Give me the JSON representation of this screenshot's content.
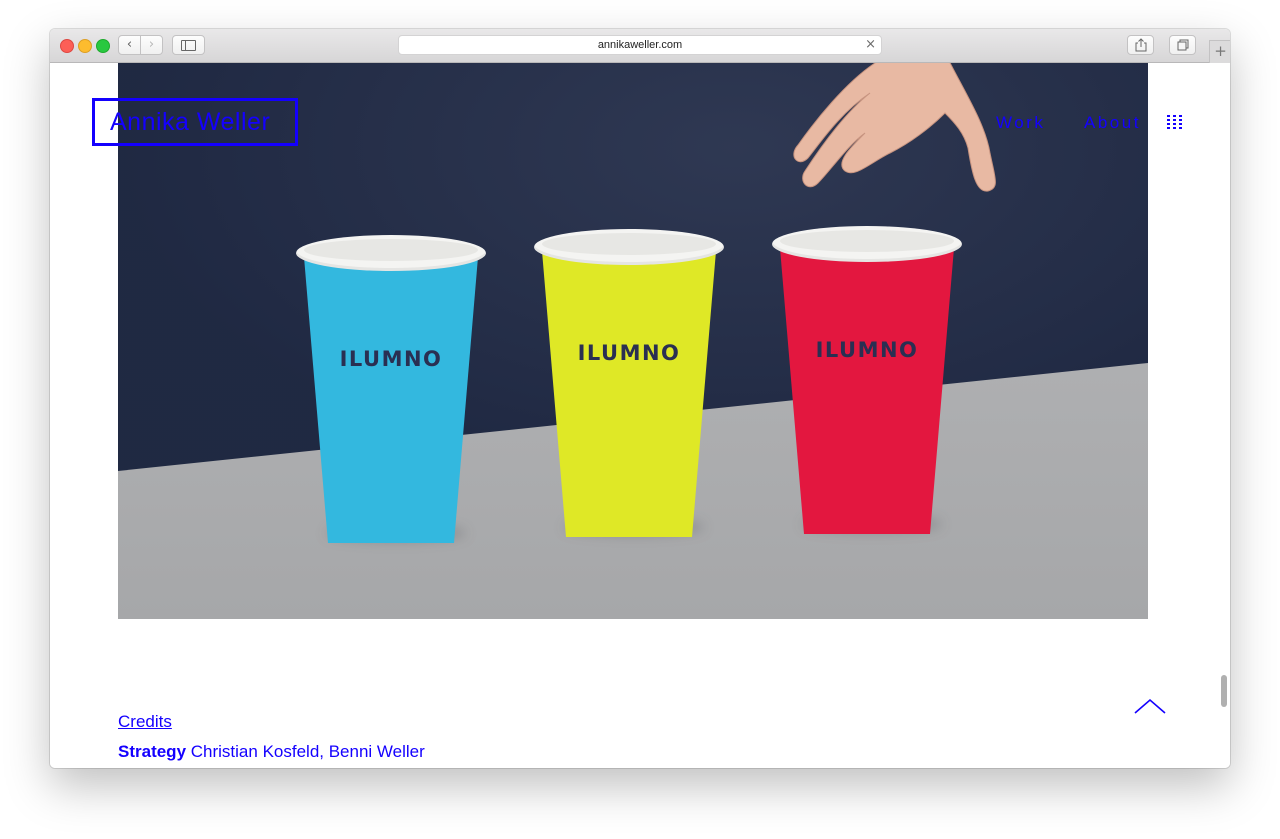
{
  "browser": {
    "url": "annikaweller.com",
    "back_glyph": "‹",
    "forward_glyph": "›",
    "close_glyph": "×",
    "new_tab_glyph": "+",
    "icons": [
      "back-icon",
      "forward-icon",
      "sidebar-icon",
      "share-icon",
      "tabs-icon",
      "new-tab-icon"
    ]
  },
  "site": {
    "logo": "Annika Weller",
    "nav": {
      "work": "Work",
      "about": "About"
    },
    "menu_icon": "grid-icon",
    "accent_color": "#1400ff"
  },
  "hero": {
    "cups": [
      {
        "color": "#33b8df",
        "label": "ILUMNO"
      },
      {
        "color": "#dfe826",
        "label": "ILUMNO"
      },
      {
        "color": "#e3173f",
        "label": "ILUMNO"
      }
    ]
  },
  "credits": {
    "heading": "Credits",
    "role": "Strategy",
    "names": "Christian Kosfeld, Benni Weller"
  },
  "back_to_top_icon": "chevron-up-icon"
}
